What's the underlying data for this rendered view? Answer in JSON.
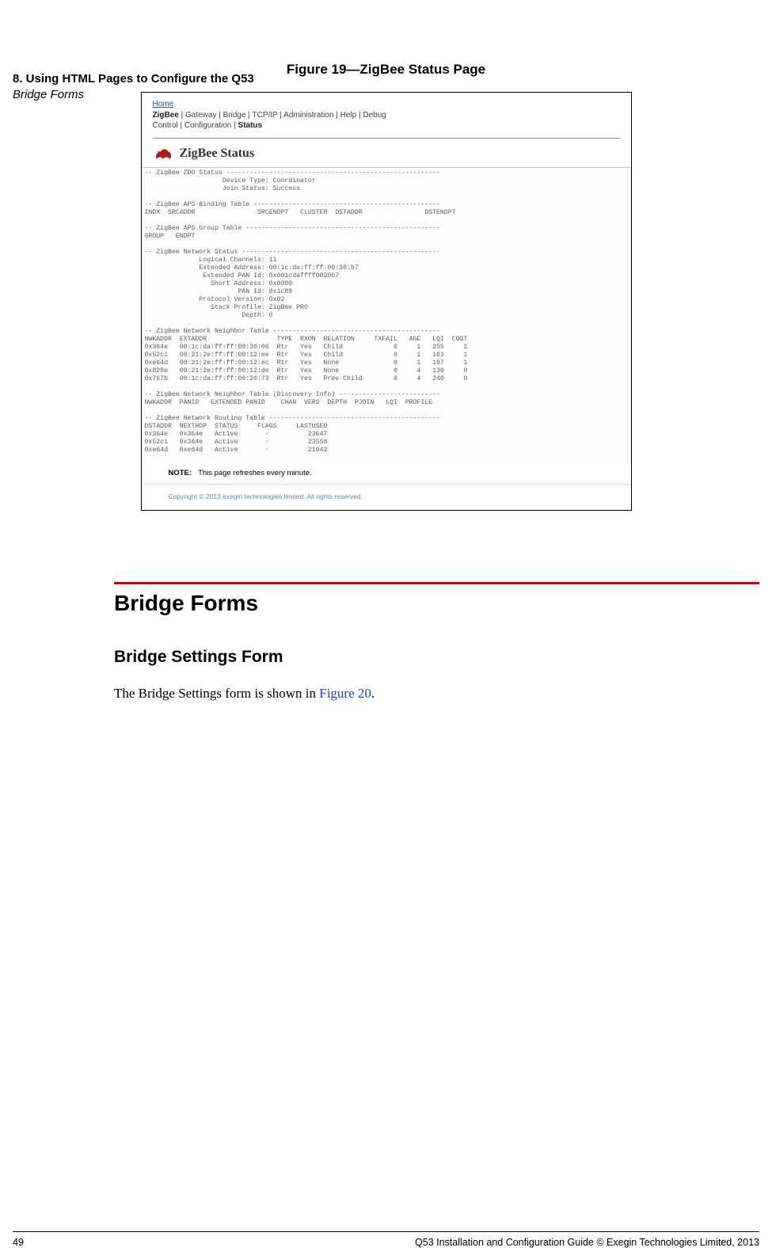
{
  "header": {
    "title_line1": "8. Using HTML Pages to Configure the Q53",
    "title_line2": "Bridge Forms"
  },
  "figure": {
    "caption": "Figure 19—ZigBee Status Page"
  },
  "screenshot": {
    "breadcrumb": {
      "home": "Home",
      "row1_prefix_bold": "ZigBee",
      "row1_rest": " | Gateway | Bridge | TCP/IP | Administration | Help | Debug",
      "row2_prefix": "Control | Configuration | ",
      "row2_bold": "Status"
    },
    "title": "ZigBee Status",
    "pre": "-- ZigBee ZDO Status -------------------------------------------------------\n                    Device Type: Coordinator\n                    Join Status: Success\n\n-- ZigBee APS Binding Table ------------------------------------------------\nINDX  SRCADDR                SRCENDPT   CLUSTER  DSTADDR                DSTENDPT\n\n-- ZigBee APS Group Table --------------------------------------------------\nGROUP   ENDPT\n\n-- ZigBee Network Status ---------------------------------------------------\n              Logical Channels: 11\n              Extended Address: 00:1c:da:ff:ff:00:30:b7\n               Extended PAN Id: 0x001cdaffff0030b7\n                 Short Address: 0x0000\n                        PAN Id: 0x1c89\n              Protocol Version: 0x02\n                 Stack Profile: ZigBee PRO\n                         Depth: 0\n\n-- ZigBee Network Neighbor Table -------------------------------------------\nNWKADDR  EXTADDR                  TYPE  RXON  RELATION     TXFAIL   AGE   LQI  COST\n0x364e   00:1c:da:ff:ff:00:30:06  Rtr   Yes   Child             0     1   255     1\n0x52c1   00:21:2e:ff:ff:00:12:ee  Rtr   Yes   Child             0     1   163     1\n0xe64d   00:21:2e:ff:ff:00:12:ec  Rtr   Yes   None              0     1   197     1\n0x828e   00:21:2e:ff:ff:00:12:de  Rtr   Yes   None              0     4   130     0\n0x767b   00:1c:da:ff:ff:00:20:73  Rtr   Yes   Prev Child        0     4   240     0\n\n-- ZigBee Network Neighbor Table (Discovery Info) --------------------------\nNWKADDR  PANID   EXTENDED PANID    CHAN  VERS  DEPTH  PJOIN   LQI  PROFILE\n\n-- ZigBee Network Routing Table --------------------------------------------\nDSTADDR  NEXTHOP  STATUS     FLAGS     LASTUSED\n0x364e   0x364e   Active       -          23647\n0x52c1   0x364e   Active       -          23558\n0xe64d   0xe64d   Active       -          21942",
    "note_label": "NOTE:",
    "note_text": "This page refreshes every minute.",
    "copyright": "Copyright © 2013 exegin technologies limited. All rights reserved."
  },
  "section": {
    "h1": "Bridge Forms",
    "h2": "Bridge Settings Form",
    "body_prefix": "The Bridge Settings form is shown in ",
    "body_link": "Figure 20",
    "body_suffix": "."
  },
  "footer": {
    "page": "49",
    "text": "Q53 Installation and Configuration Guide  © Exegin Technologies Limited, 2013"
  }
}
